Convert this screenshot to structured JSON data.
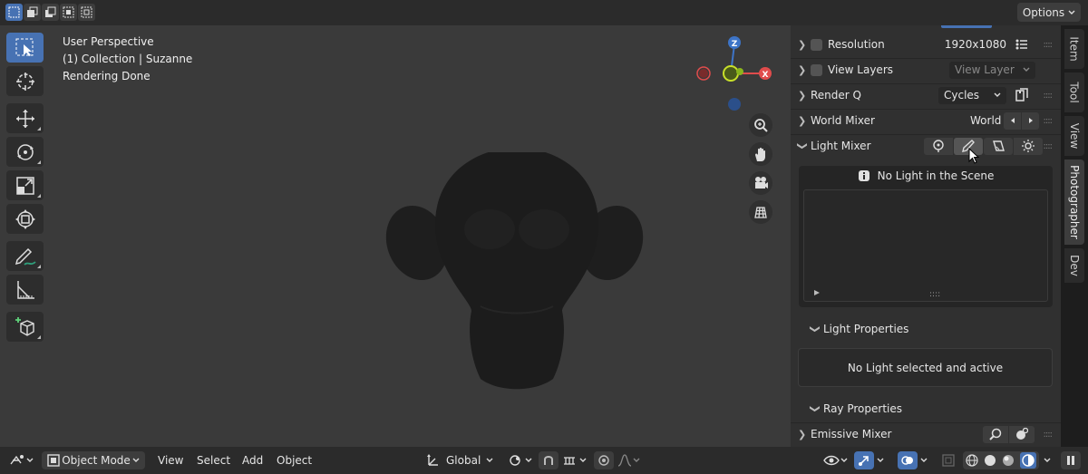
{
  "topbar": {
    "options_label": "Options",
    "select_modes": [
      "select-set-icon",
      "select-extend-icon",
      "select-subtract-icon",
      "select-invert-icon",
      "select-intersect-icon"
    ]
  },
  "viewport": {
    "info_lines": [
      "User Perspective",
      "(1) Collection | Suzanne",
      "Rendering Done"
    ],
    "gizmo": {
      "z_label": "Z",
      "x_label": "X"
    },
    "tools": [
      "select-box-icon",
      "cursor-icon",
      "move-icon",
      "rotate-icon",
      "scale-icon",
      "transform-icon",
      "annotate-icon",
      "measure-icon",
      "add-cube-icon"
    ],
    "nav": [
      "zoom-icon",
      "pan-hand-icon",
      "camera-icon",
      "grid-ortho-icon"
    ]
  },
  "npanel": {
    "resolution": {
      "label": "Resolution",
      "value": "1920x1080"
    },
    "view_layers": {
      "label": "View Layers",
      "dropdown": "View Layer"
    },
    "render_q": {
      "label": "Render Q",
      "dropdown": "Cycles"
    },
    "world_mixer": {
      "label": "World Mixer",
      "value": "World"
    },
    "light_mixer": {
      "label": "Light Mixer",
      "icons": [
        "point-light-icon",
        "spot-light-icon",
        "area-light-icon",
        "sun-light-icon"
      ]
    },
    "no_light_msg": "No Light in the Scene",
    "light_properties": {
      "label": "Light Properties",
      "message": "No Light selected and active"
    },
    "ray_properties": {
      "label": "Ray Properties"
    },
    "emissive_mixer": {
      "label": "Emissive Mixer"
    }
  },
  "tabs": [
    "Item",
    "Tool",
    "View",
    "Photographer",
    "Dev"
  ],
  "bottombar": {
    "mode": "Object Mode",
    "menus": [
      "View",
      "Select",
      "Add",
      "Object"
    ],
    "orientation": "Global"
  },
  "colors": {
    "accent": "#4772b3",
    "x_axis": "#e04c4c",
    "y_axis": "#8ab51d",
    "z_axis": "#3d74c7"
  }
}
